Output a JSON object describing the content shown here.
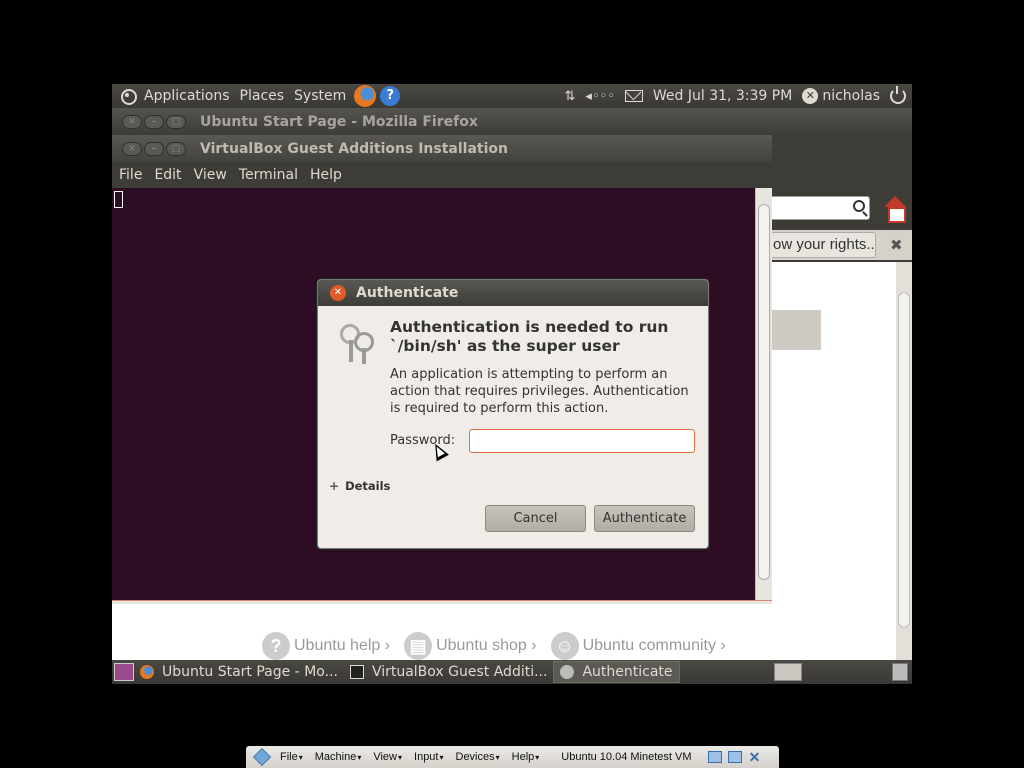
{
  "top_panel": {
    "menus": [
      "Applications",
      "Places",
      "System"
    ],
    "datetime": "Wed Jul 31,  3:39 PM",
    "username": "nicholas",
    "network_glyph": "⇅",
    "volume_glyph": "🔈"
  },
  "firefox_window": {
    "title": "Ubuntu Start Page - Mozilla Firefox",
    "notification_text": "ow your rights...",
    "footer_links": [
      {
        "label": "Ubuntu help ›",
        "icon": "?"
      },
      {
        "label": "Ubuntu shop ›",
        "icon": "▤"
      },
      {
        "label": "Ubuntu community ›",
        "icon": "☺"
      }
    ]
  },
  "terminal_window": {
    "title": "VirtualBox Guest Additions Installation",
    "menus": [
      "File",
      "Edit",
      "View",
      "Terminal",
      "Help"
    ]
  },
  "dialog": {
    "title": "Authenticate",
    "heading": "Authentication is needed to run `/bin/sh' as the super user",
    "message": "An application is attempting to perform an action that requires privileges. Authentication is required to perform this action.",
    "password_label": "Password:",
    "password_value": "",
    "details_label": "Details",
    "cancel_label": "Cancel",
    "authenticate_label": "Authenticate",
    "colors": {
      "focus_border": "#e07048",
      "close_button": "#e05a2a"
    }
  },
  "bottom_panel": {
    "tasks": [
      {
        "label": "Ubuntu Start Page - Mo...",
        "icon": "firefox-icon"
      },
      {
        "label": "VirtualBox Guest Additi...",
        "icon": "terminal-icon"
      },
      {
        "label": "Authenticate",
        "icon": "keys-icon",
        "active": true
      }
    ]
  },
  "vbox_bar": {
    "menus": [
      "File",
      "Machine",
      "View",
      "Input",
      "Devices",
      "Help"
    ],
    "vm_name": "Ubuntu 10.04 Minetest VM"
  },
  "theme": {
    "desktop_bg": "#000000",
    "terminal_bg": "#2c0d24",
    "panel_bg": "#3a3834"
  }
}
